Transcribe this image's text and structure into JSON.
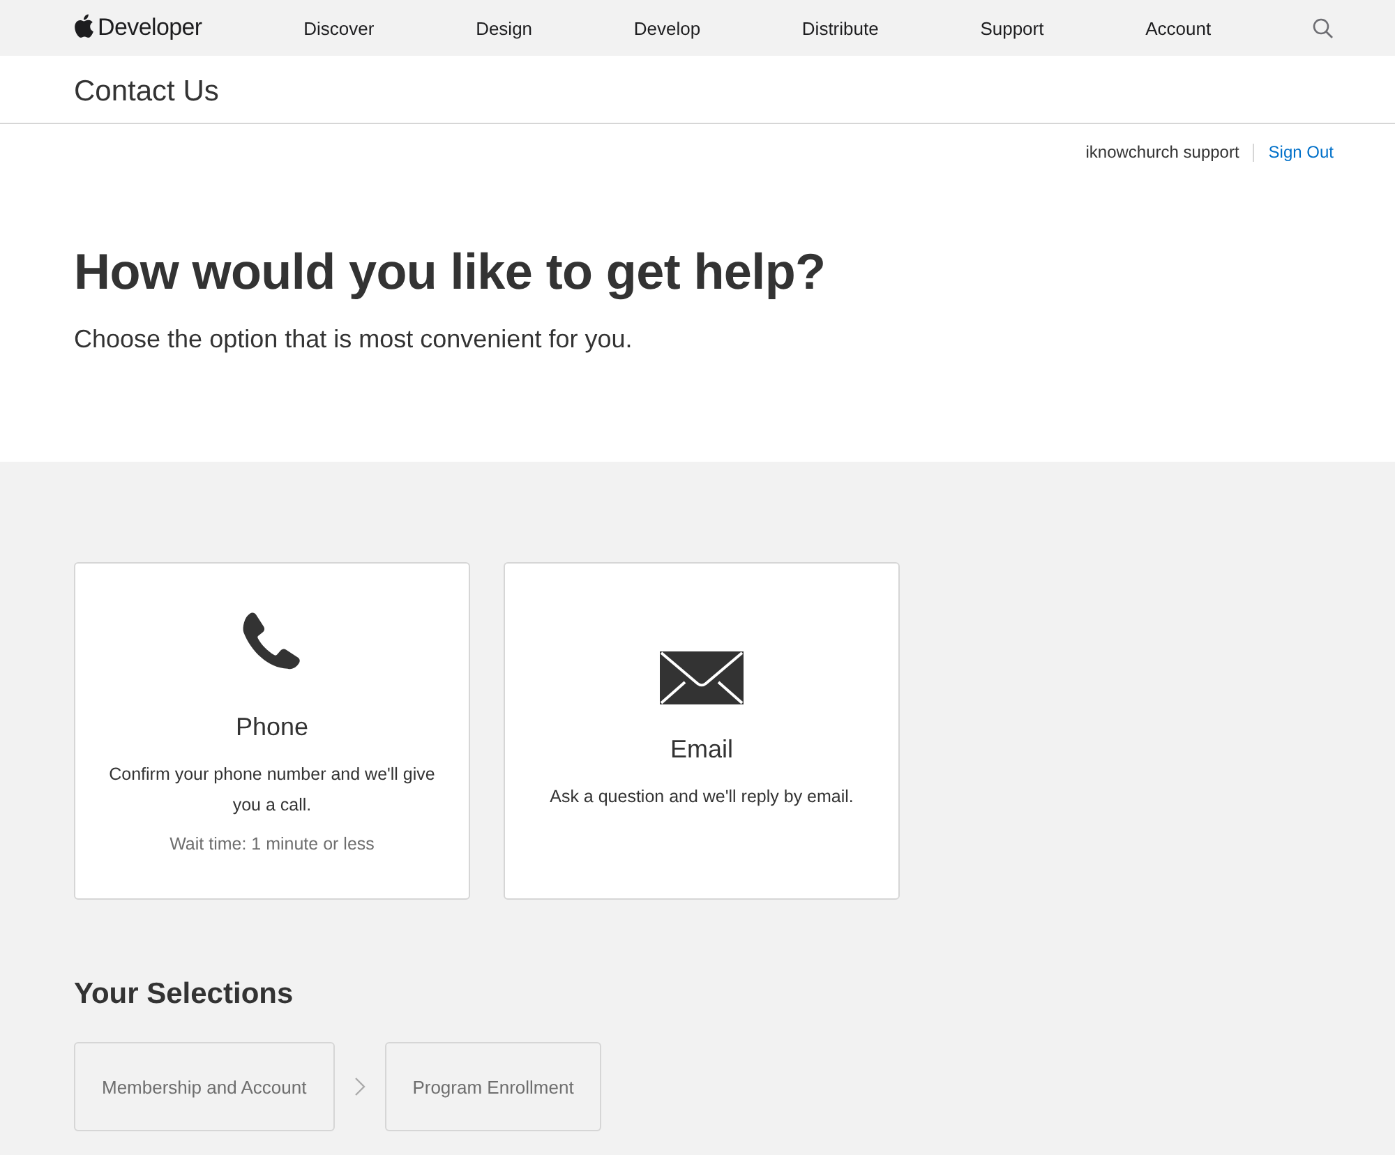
{
  "nav": {
    "brand": "Developer",
    "items": [
      "Discover",
      "Design",
      "Develop",
      "Distribute",
      "Support",
      "Account"
    ]
  },
  "page_title": "Contact Us",
  "user": {
    "name": "iknowchurch support",
    "sign_out": "Sign Out"
  },
  "hero": {
    "heading": "How would you like to get help?",
    "subheading": "Choose the option that is most convenient for you."
  },
  "options": [
    {
      "kind": "phone",
      "title": "Phone",
      "description": "Confirm your phone number and we'll give you a call.",
      "note": "Wait time: 1 minute or less"
    },
    {
      "kind": "email",
      "title": "Email",
      "description": "Ask a question and we'll reply by email."
    }
  ],
  "selections": {
    "heading": "Your Selections",
    "items": [
      "Membership and Account",
      "Program Enrollment"
    ]
  }
}
